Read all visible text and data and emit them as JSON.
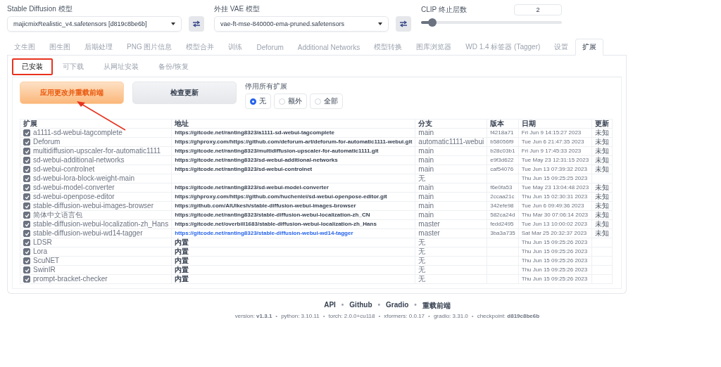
{
  "model_selectors": [
    {
      "label": "Stable Diffusion 模型",
      "value": "majicmixRealistic_v4.safetensors [d819c8be6b]"
    },
    {
      "label": "外挂 VAE 模型",
      "value": "vae-ft-mse-840000-ema-pruned.safetensors"
    }
  ],
  "clip_skip": {
    "label": "CLIP 终止层数",
    "value": "2",
    "level": 0.08
  },
  "tabs": [
    {
      "label": "文生图",
      "selected": false
    },
    {
      "label": "图生图",
      "selected": false
    },
    {
      "label": "后期处理",
      "selected": false
    },
    {
      "label": "PNG 图片信息",
      "selected": false
    },
    {
      "label": "模型合并",
      "selected": false
    },
    {
      "label": "训练",
      "selected": false
    },
    {
      "label": "Deforum",
      "selected": false
    },
    {
      "label": "Additional Networks",
      "selected": false
    },
    {
      "label": "模型转换",
      "selected": false
    },
    {
      "label": "图库浏览器",
      "selected": false
    },
    {
      "label": "WD 1.4 标签器 (Tagger)",
      "selected": false
    },
    {
      "label": "设置",
      "selected": false
    },
    {
      "label": "扩展",
      "selected": true
    }
  ],
  "subtabs": [
    {
      "label": "已安装",
      "selected": true
    },
    {
      "label": "可下载",
      "selected": false
    },
    {
      "label": "从网址安装",
      "selected": false
    },
    {
      "label": "备份/恢复",
      "selected": false
    }
  ],
  "buttons": [
    {
      "label": "应用更改并重载前端",
      "kind": "primary"
    },
    {
      "label": "检查更新",
      "kind": "secondary"
    }
  ],
  "disable_all": {
    "label": "停用所有扩展",
    "options": [
      {
        "label": "无",
        "selected": true
      },
      {
        "label": "额外",
        "selected": false
      },
      {
        "label": "全部",
        "selected": false
      }
    ]
  },
  "table": {
    "columns": [
      "扩展",
      "地址",
      "分支",
      "版本",
      "日期",
      "更新"
    ],
    "rows": [
      {
        "enabled": true,
        "name": "a1111-sd-webui-tagcomplete",
        "url": "https://gitcode.net/ranting8323/a1111-sd-webui-tagcomplete",
        "branch": "main",
        "version": "f4218a71",
        "date": "Fri Jun 9 14:15:27 2023",
        "update": "未知"
      },
      {
        "enabled": true,
        "name": "Deforum",
        "url": "https://ghproxy.com/https://github.com/deforum-art/deforum-for-automatic1111-webui.git",
        "branch": "automatic1111-webui",
        "version": "b58056f9",
        "date": "Tue Jun 6 21:47:35 2023",
        "update": "未知"
      },
      {
        "enabled": true,
        "name": "multidiffusion-upscaler-for-automatic1111",
        "url": "https://gitcode.net/ranting8323/multidiffusion-upscaler-for-automatic1111.git",
        "branch": "main",
        "version": "b28c03b1",
        "date": "Fri Jun 9 17:45:33 2023",
        "update": "未知"
      },
      {
        "enabled": true,
        "name": "sd-webui-additional-networks",
        "url": "https://gitcode.net/ranting8323/sd-webui-additional-networks",
        "branch": "main",
        "version": "e9f3d622",
        "date": "Tue May 23 12:31:15 2023",
        "update": "未知"
      },
      {
        "enabled": true,
        "name": "sd-webui-controlnet",
        "url": "https://gitcode.net/ranting8323/sd-webui-controlnet",
        "branch": "main",
        "version": "caf54076",
        "date": "Tue Jun 13 07:39:32 2023",
        "update": "未知"
      },
      {
        "enabled": true,
        "name": "sd-webui-lora-block-weight-main",
        "branch": "无",
        "date": "Thu Jun 15 09:25:25 2023"
      },
      {
        "enabled": true,
        "name": "sd-webui-model-converter",
        "url": "https://gitcode.net/ranting8323/sd-webui-model-converter",
        "branch": "main",
        "version": "f6e0fa53",
        "date": "Tue May 23 13:04:48 2023",
        "update": "未知"
      },
      {
        "enabled": true,
        "name": "sd-webui-openpose-editor",
        "url": "https://ghproxy.com/https://github.com/huchenlei/sd-webui-openpose-editor.git",
        "branch": "main",
        "version": "2ccaa21c",
        "date": "Thu Jun 15 02:30:31 2023",
        "update": "未知"
      },
      {
        "enabled": true,
        "name": "stable-diffusion-webui-images-browser",
        "url": "https://github.com/AlUlkesh/stable-diffusion-webui-images-browser",
        "branch": "main",
        "version": "342efe98",
        "date": "Tue Jun 6 09:49:36 2023",
        "update": "未知"
      },
      {
        "enabled": true,
        "name": "简体中文语言包",
        "url": "https://gitcode.net/ranting8323/stable-diffusion-webui-localization-zh_CN",
        "branch": "main",
        "version": "582ca24d",
        "date": "Thu Mar 30 07:06:14 2023",
        "update": "未知"
      },
      {
        "enabled": true,
        "name": "stable-diffusion-webui-localization-zh_Hans",
        "url": "https://gitcode.net/overbill1683/stable-diffusion-webui-localization-zh_Hans",
        "branch": "master",
        "version": "fedd2495",
        "date": "Tue Jun 13 10:00:02 2023",
        "update": "未知"
      },
      {
        "enabled": true,
        "name": "stable-diffusion-webui-wd14-tagger",
        "url": "https://gitcode.net/ranting8323/stable-diffusion-webui-wd14-tagger",
        "link": true,
        "branch": "master",
        "version": "3ba3a735",
        "date": "Sat Mar 25 20:32:37 2023",
        "update": "未知"
      },
      {
        "enabled": true,
        "name": "LDSR",
        "url": "内置",
        "builtin": true,
        "branch": "无",
        "date": "Thu Jun 15 09:25:26 2023"
      },
      {
        "enabled": true,
        "name": "Lora",
        "url": "内置",
        "builtin": true,
        "branch": "无",
        "date": "Thu Jun 15 09:25:26 2023"
      },
      {
        "enabled": true,
        "name": "ScuNET",
        "url": "内置",
        "builtin": true,
        "branch": "无",
        "date": "Thu Jun 15 09:25:26 2023"
      },
      {
        "enabled": true,
        "name": "SwinIR",
        "url": "内置",
        "builtin": true,
        "branch": "无",
        "date": "Thu Jun 15 09:25:26 2023"
      },
      {
        "enabled": true,
        "name": "prompt-bracket-checker",
        "url": "内置",
        "builtin": true,
        "branch": "无",
        "date": "Thu Jun 15 09:25:26 2023"
      }
    ]
  },
  "footer": {
    "separator": "•",
    "links": [
      "API",
      "Github",
      "Gradio",
      "重载前端"
    ],
    "versions": [
      "version: **v1.3.1**",
      "python: 3.10.11",
      "torch: 2.0.0+cu118",
      "xformers: 0.0.17",
      "gradio: 3.31.0",
      "checkpoint: **d819c8be6b**"
    ]
  }
}
